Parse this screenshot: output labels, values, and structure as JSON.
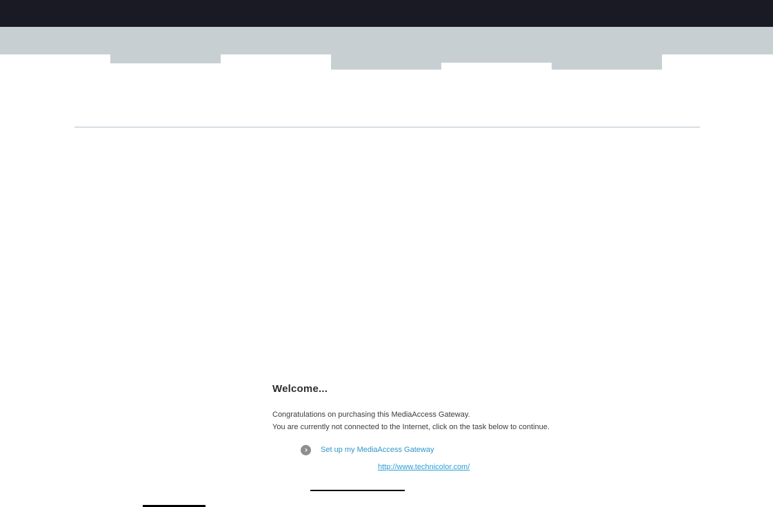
{
  "header": {
    "top_bar_color": "#191a23",
    "menu_bar_color": "#c8cfd2",
    "tab_placeholders": 4
  },
  "content": {
    "title": "Welcome...",
    "paragraph1": "Congratulations on purchasing this MediaAccess Gateway.",
    "paragraph2": "You are currently not connected to the Internet, click on the task below to continue.",
    "task_label": "Set up my MediaAccess Gateway",
    "task_icon": "chevron-right-circle-icon",
    "task_icon_glyph": "›",
    "site_link": "http://www.technicolor.com/"
  },
  "colors": {
    "top_bar": "#191a23",
    "menu_bar": "#c8cfd2",
    "divider_line": "#b4c0c7",
    "heading_text": "#2d2d2d",
    "body_text": "#3c3c3c",
    "task_link_blue": "#2e96c8",
    "site_link_blue": "#2a9fd8",
    "task_icon_bg": "#8e8e8e",
    "rule_black": "#000000"
  }
}
